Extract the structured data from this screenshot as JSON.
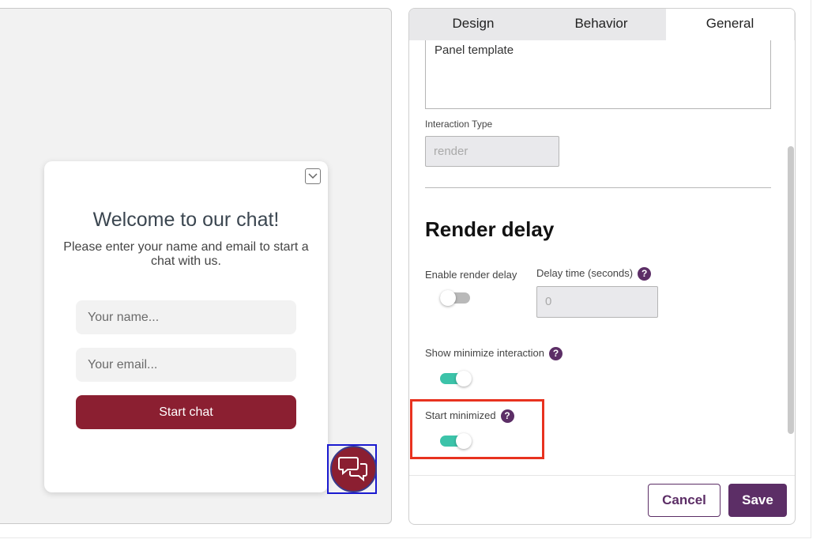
{
  "preview": {
    "chat_title": "Welcome to our chat!",
    "chat_subtitle": "Please enter your name and email to start a chat with us.",
    "name_placeholder": "Your name...",
    "email_placeholder": "Your email...",
    "start_button": "Start chat"
  },
  "tabs": [
    {
      "label": "Design",
      "active": false
    },
    {
      "label": "Behavior",
      "active": false
    },
    {
      "label": "General",
      "active": true
    }
  ],
  "general": {
    "template_text": "Panel template",
    "interaction_type_label": "Interaction Type",
    "interaction_type_value": "render",
    "section_title": "Render delay",
    "enable_render_delay_label": "Enable render delay",
    "enable_render_delay_on": false,
    "delay_time_label": "Delay time (seconds)",
    "delay_time_value": "0",
    "show_minimize_label": "Show minimize interaction",
    "show_minimize_on": true,
    "start_minimized_label": "Start minimized",
    "start_minimized_on": true,
    "help_symbol": "?"
  },
  "footer": {
    "cancel_label": "Cancel",
    "save_label": "Save"
  },
  "colors": {
    "brand": "#8b1f31",
    "accent": "#5c2e66",
    "toggle_on": "#3cc3a9",
    "highlight": "#e8321f"
  }
}
